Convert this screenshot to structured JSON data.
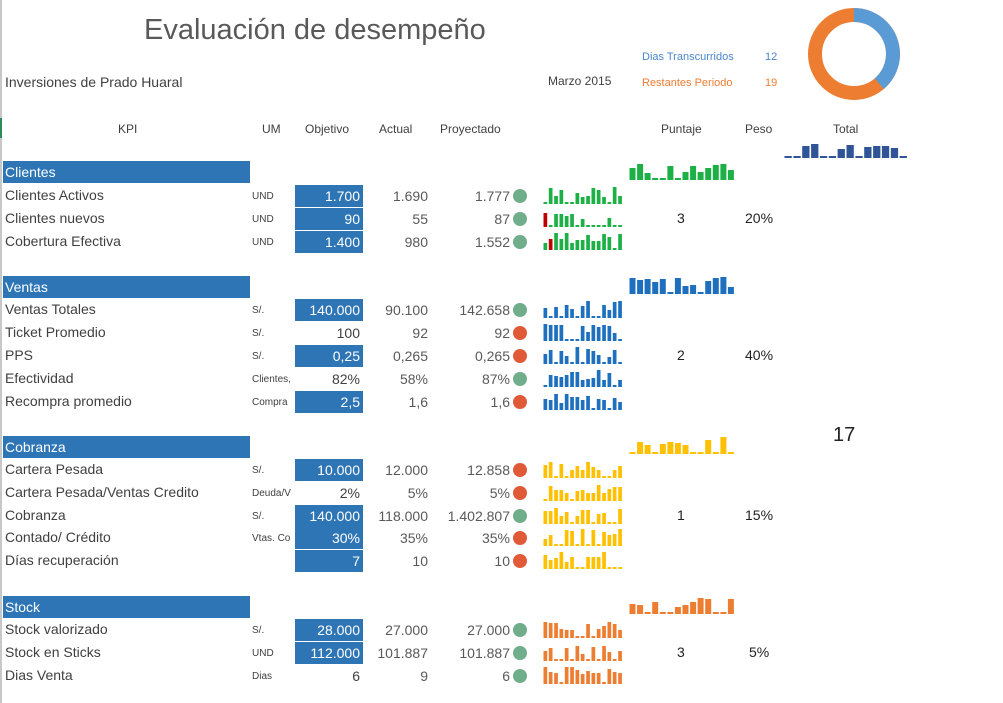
{
  "header": {
    "title": "Evaluación de desempeño",
    "company": "Inversiones de Prado Huaral",
    "month": "Marzo 2015",
    "elapsed_label": "Dias Transcurridos",
    "elapsed_value": "12",
    "remaining_label": "Restantes Periodo",
    "remaining_value": "19",
    "donut": {
      "elapsed": 12,
      "remaining": 19,
      "elapsed_color": "#5b9bd5",
      "remaining_color": "#ed7d31"
    }
  },
  "columns": {
    "kpi": "KPI",
    "um": "UM",
    "objective": "Objetivo",
    "actual": "Actual",
    "projected": "Proyectado",
    "score": "Puntaje",
    "weight": "Peso",
    "total": "Total"
  },
  "total_score": "17",
  "colors": {
    "clientes": "#1db046",
    "ventas": "#1f6fbf",
    "cobranza": "#ffc000",
    "stock": "#ed7d31",
    "total": "#2f5597",
    "neg": "#c00000"
  },
  "sections": [
    {
      "id": "clientes",
      "title": "Clientes",
      "score": "3",
      "weight": "20%",
      "rows": [
        {
          "name": "Clientes Activos",
          "um": "UND",
          "objective": "1.700",
          "actual": "1.690",
          "projected": "1.777",
          "status": "g",
          "fill": true
        },
        {
          "name": "Clientes nuevos",
          "um": "UND",
          "objective": "90",
          "actual": "55",
          "projected": "87",
          "status": "g",
          "fill": true
        },
        {
          "name": "Cobertura Efectiva",
          "um": "UND",
          "objective": "1.400",
          "actual": "980",
          "projected": "1.552",
          "status": "g",
          "fill": true
        }
      ]
    },
    {
      "id": "ventas",
      "title": "Ventas",
      "score": "2",
      "weight": "40%",
      "rows": [
        {
          "name": "Ventas Totales",
          "um": "S/.",
          "objective": "140.000",
          "actual": "90.100",
          "projected": "142.658",
          "status": "g",
          "fill": true
        },
        {
          "name": "Ticket Promedio",
          "um": "S/.",
          "objective": "100",
          "actual": "92",
          "projected": "92",
          "status": "r",
          "fill": false
        },
        {
          "name": "PPS",
          "um": "S/.",
          "objective": "0,25",
          "actual": "0,265",
          "projected": "0,265",
          "status": "r",
          "fill": true
        },
        {
          "name": "Efectividad",
          "um": "Clientes,",
          "objective": "82%",
          "actual": "58%",
          "projected": "87%",
          "status": "g",
          "fill": false
        },
        {
          "name": "Recompra promedio",
          "um": "Compra",
          "objective": "2,5",
          "actual": "1,6",
          "projected": "1,6",
          "status": "r",
          "fill": true
        }
      ]
    },
    {
      "id": "cobranza",
      "title": "Cobranza",
      "score": "1",
      "weight": "15%",
      "rows": [
        {
          "name": "Cartera Pesada",
          "um": "S/.",
          "objective": "10.000",
          "actual": "12.000",
          "projected": "12.858",
          "status": "r",
          "fill": true
        },
        {
          "name": "Cartera Pesada/Ventas Credito",
          "um": "Deuda/V",
          "objective": "2%",
          "actual": "5%",
          "projected": "5%",
          "status": "r",
          "fill": false
        },
        {
          "name": "Cobranza",
          "um": "S/.",
          "objective": "140.000",
          "actual": "118.000",
          "projected": "1.402.807",
          "status": "g",
          "fill": true
        },
        {
          "name": "Contado/ Crédito",
          "um": "Vtas. Co",
          "objective": "30%",
          "actual": "35%",
          "projected": "35%",
          "status": "r",
          "fill": true
        },
        {
          "name": "Días recuperación",
          "um": "",
          "objective": "7",
          "actual": "10",
          "projected": "10",
          "status": "r",
          "fill": true
        }
      ]
    },
    {
      "id": "stock",
      "title": "Stock",
      "score": "3",
      "weight": "5%",
      "rows": [
        {
          "name": "Stock valorizado",
          "um": "S/.",
          "objective": "28.000",
          "actual": "27.000",
          "projected": "27.000",
          "status": "g",
          "fill": true
        },
        {
          "name": "Stock en Sticks",
          "um": "UND",
          "objective": "112.000",
          "actual": "101.887",
          "projected": "101.887",
          "status": "g",
          "fill": true
        },
        {
          "name": "Dias Venta",
          "um": "Dias",
          "objective": "6",
          "actual": "9",
          "projected": "6",
          "status": "g",
          "fill": false
        }
      ]
    }
  ]
}
